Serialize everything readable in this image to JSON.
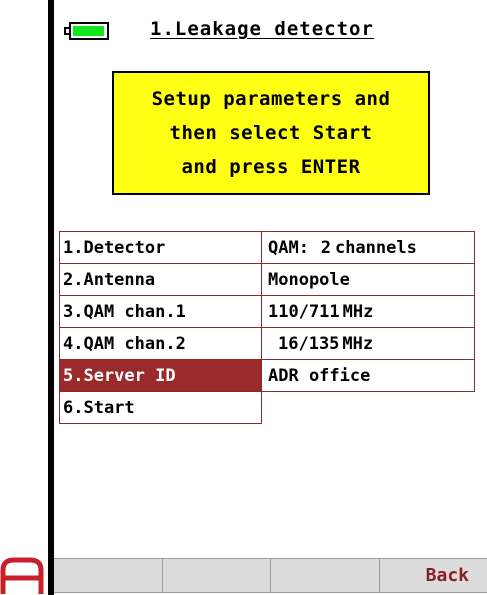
{
  "header": {
    "title": "1.Leakage detector",
    "battery_color": "#14e61e"
  },
  "instruction": {
    "lines": [
      "Setup parameters and",
      "then select Start",
      "and press ENTER"
    ],
    "background": "#ffff14"
  },
  "params": {
    "rows": [
      {
        "label": "1.Detector",
        "value": "QAM:",
        "value_num": "2",
        "value_unit": "channels"
      },
      {
        "label": "2.Antenna",
        "value": "Monopole"
      },
      {
        "label": "3.QAM chan.1",
        "value": "110/711",
        "value_unit": "MHz"
      },
      {
        "label": "4.QAM chan.2",
        "value": "16/135",
        "value_unit": "MHz"
      },
      {
        "label": "5.Server ID",
        "value": "ADR office",
        "selected": true
      },
      {
        "label": "6.Start",
        "value": ""
      }
    ],
    "selected_color": "#9b2a2a",
    "border_color": "#8a2a2a"
  },
  "softkeys": [
    "",
    "",
    "",
    "Back"
  ]
}
